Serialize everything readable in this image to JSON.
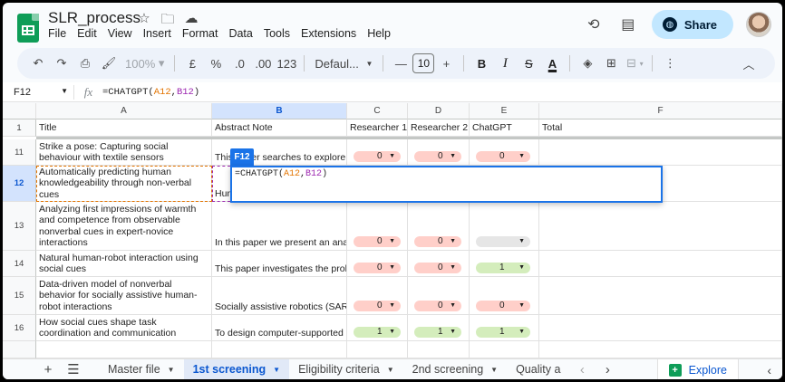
{
  "doc": {
    "title": "SLR_process"
  },
  "menu": [
    "File",
    "Edit",
    "View",
    "Insert",
    "Format",
    "Data",
    "Tools",
    "Extensions",
    "Help"
  ],
  "share_label": "Share",
  "toolbar": {
    "zoom": "100%",
    "currency": "£",
    "percent": "%",
    "dec_decrease": ".0",
    "dec_increase": ".00",
    "number_format": "123",
    "font": "Defaul...",
    "font_size": "10"
  },
  "formula_bar": {
    "name_box": "F12",
    "fx": "fx",
    "formula_prefix": "=CHATGPT(",
    "ref_a": "A12",
    "comma": ",",
    "ref_b": "B12",
    "formula_suffix": ")"
  },
  "columns": [
    "A",
    "B",
    "C",
    "D",
    "E",
    "F"
  ],
  "header_row": {
    "num": "1",
    "title": "Title",
    "abstract": "Abstract Note",
    "r1": "Researcher 1",
    "r2": "Researcher 2",
    "gpt": "ChatGPT",
    "total": "Total"
  },
  "rows": [
    {
      "num": "11",
      "title": "Strike a pose: Capturing social behaviour with textile sensors",
      "abstract": "This paper searches to explore th",
      "r1": "0",
      "r2": "0",
      "gpt": "0"
    },
    {
      "num": "12",
      "title": "Automatically predicting human knowledgeability through non-verbal cues",
      "abstract": "Hum",
      "r1": "",
      "r2": "",
      "gpt": ""
    },
    {
      "num": "13",
      "title": "Analyzing first impressions of warmth and competence from observable nonverbal cues in expert-novice interactions",
      "abstract": "In this paper we present an ana",
      "r1": "0",
      "r2": "0",
      "gpt": ""
    },
    {
      "num": "14",
      "title": "Natural human-robot interaction using social cues",
      "abstract": "This paper investigates the prob",
      "r1": "0",
      "r2": "0",
      "gpt": "1"
    },
    {
      "num": "15",
      "title": "Data-driven model of nonverbal behavior for socially assistive human-robot interactions",
      "abstract": "Socially assistive robotics (SAR",
      "r1": "0",
      "r2": "0",
      "gpt": "0"
    },
    {
      "num": "16",
      "title": "How social cues shape task coordination and communication",
      "abstract": "To design computer-supported c",
      "r1": "1",
      "r2": "1",
      "gpt": "1"
    }
  ],
  "active_cell": "F12",
  "editor_text": {
    "prefix": "=CHATGPT(",
    "ref_a": "A12",
    "comma": ",",
    "ref_b": "B12",
    "suffix": ")"
  },
  "tabs": [
    "Master file",
    "1st screening",
    "Eligibility criteria",
    "2nd screening",
    "Quality a"
  ],
  "active_tab": "1st screening",
  "explore_label": "Explore",
  "colors": {
    "red_chip": "#ffcfc9",
    "green_chip": "#d4edbc",
    "grey_chip": "#e6e6e6",
    "accent": "#1a73e8"
  }
}
